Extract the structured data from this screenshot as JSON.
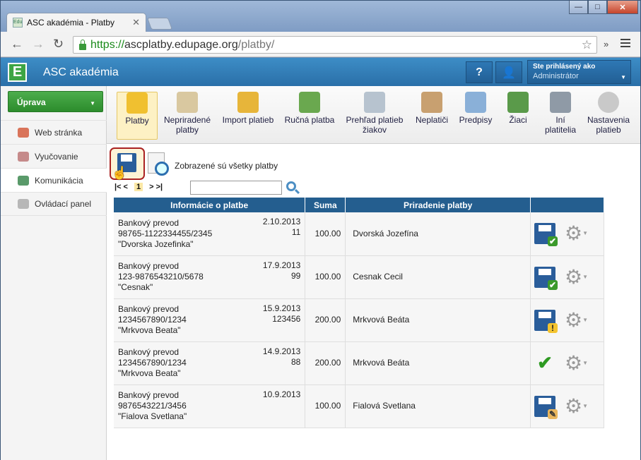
{
  "browser": {
    "tab_title": "ASC akadémia - Platby",
    "favicon_text": "Edu",
    "tab_close": "✕",
    "url_scheme": "https://",
    "url_host": "ascplatby.edupage.org",
    "url_path": "/platby/",
    "back_icon": "arrow-left-icon",
    "forward_icon": "arrow-right-icon",
    "reload_icon": "reload-icon",
    "star": "☆",
    "ext": "»"
  },
  "app": {
    "logo": "E",
    "name": "ASC akadémia",
    "help": "?",
    "user_label": "Ste prihlásený ako",
    "user_name": "Administrátor",
    "accent": "#2a6fa8"
  },
  "sidebar": {
    "section_button": "Úprava",
    "items": [
      {
        "label": "Web stránka"
      },
      {
        "label": "Vyučovanie"
      },
      {
        "label": "Komunikácia"
      },
      {
        "label": "Ovládací panel"
      }
    ]
  },
  "ribbon": [
    {
      "label": "Platby",
      "icon": "coins-pot-icon"
    },
    {
      "label": "Nepriradené platby",
      "icon": "unassigned-coins-icon"
    },
    {
      "label": "Import platieb",
      "icon": "import-coins-icon"
    },
    {
      "label": "Ručná platba",
      "icon": "wallet-icon"
    },
    {
      "label": "Prehľad platieb žiakov",
      "icon": "overview-icon"
    },
    {
      "label": "Neplatiči",
      "icon": "money-bag-clock-icon"
    },
    {
      "label": "Predpisy",
      "icon": "calendar-icon"
    },
    {
      "label": "Žiaci",
      "icon": "students-icon"
    },
    {
      "label": "Iní platitelia",
      "icon": "building-icon"
    },
    {
      "label": "Nastavenia platieb",
      "icon": "gear-icon"
    }
  ],
  "main": {
    "status_text": "Zobrazené sú všetky platby",
    "pager": {
      "first": "|< <",
      "current": "1",
      "last": "> >|"
    },
    "search_value": "",
    "table": {
      "headers": [
        "Informácie o platbe",
        "Suma",
        "Priradenie platby",
        ""
      ],
      "rows": [
        {
          "lines": [
            "Bankový prevod",
            "98765-1122334455/2345",
            "\"Dvorska Jozefinka\""
          ],
          "date": "2.10.2013",
          "ref": "11",
          "sum": "100.00",
          "assigned": "Dvorská Jozefína",
          "status": "saved-ok"
        },
        {
          "lines": [
            "Bankový prevod",
            "123-9876543210/5678",
            "\"Cesnak\""
          ],
          "date": "17.9.2013",
          "ref": "99",
          "sum": "100.00",
          "assigned": "Cesnak Cecil",
          "status": "saved-ok"
        },
        {
          "lines": [
            "Bankový prevod",
            "1234567890/1234",
            "\"Mrkvova Beata\""
          ],
          "date": "15.9.2013",
          "ref": "123456",
          "sum": "200.00",
          "assigned": "Mrkvová Beáta",
          "status": "saved-warning"
        },
        {
          "lines": [
            "Bankový prevod",
            "1234567890/1234",
            "\"Mrkvova Beata\""
          ],
          "date": "14.9.2013",
          "ref": "88",
          "sum": "200.00",
          "assigned": "Mrkvová Beáta",
          "status": "confirmed"
        },
        {
          "lines": [
            "Bankový prevod",
            "9876543221/3456",
            "\"Fialova Svetlana\""
          ],
          "date": "10.9.2013",
          "ref": "",
          "sum": "100.00",
          "assigned": "Fialová Svetlana",
          "status": "saved-manual"
        }
      ]
    }
  }
}
